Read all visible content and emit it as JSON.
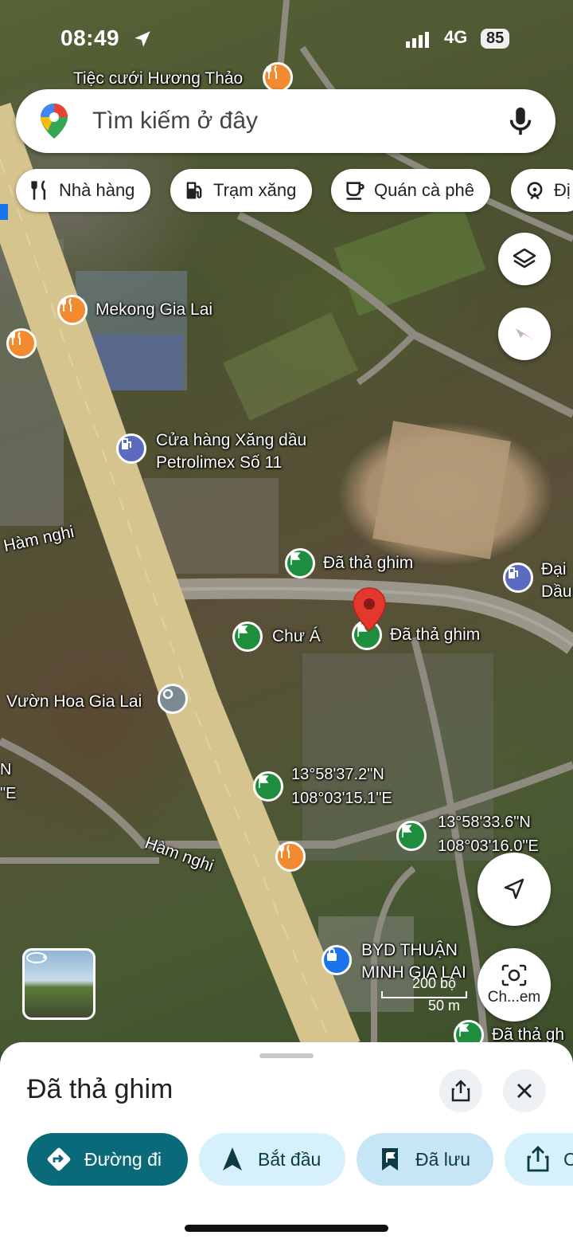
{
  "status_bar": {
    "time": "08:49",
    "network": "4G",
    "battery": "85"
  },
  "search": {
    "placeholder": "Tìm kiếm ở đây"
  },
  "chips": [
    {
      "label": "Nhà hàng",
      "icon": "fork-knife-icon"
    },
    {
      "label": "Trạm xăng",
      "icon": "gas-pump-icon"
    },
    {
      "label": "Quán cà phê",
      "icon": "coffee-cup-icon"
    },
    {
      "label": "Đị",
      "icon": "attraction-icon"
    }
  ],
  "map_labels": {
    "tiec_cuoi": "Tiệc cưới Hương Thảo",
    "mekong": "Mekong Gia Lai",
    "petrolimex_1": "Cửa hàng Xăng dầu",
    "petrolimex_2": "Petrolimex Số 11",
    "ham_nghi_1": "Hàm nghi",
    "ham_nghi_2": "Hàm nghi",
    "da_tha_ghim_top": "Đã thả ghim",
    "dai_1": "Đại",
    "dai_2": "Dầu",
    "chu_a": "Chư Á",
    "da_tha_ghim_selected": "Đã thả ghim",
    "vuon_hoa": "Vườn Hoa Gia Lai",
    "coord1_lat": "13°58'37.2\"N",
    "coord1_lng": "108°03'15.1\"E",
    "coord2_lat": "13°58'33.6\"N",
    "coord2_lng": "108°03'16.0\"E",
    "left_edge_n": "N",
    "left_edge_e": "\"E",
    "byd_1": "BYD THUẬN",
    "byd_2": "MINH GIA LAI",
    "da_tha_ghim_bottom": "Đã thả gh"
  },
  "scale": {
    "imperial": "200 bộ",
    "metric": "50 m"
  },
  "camera_button": {
    "label": "Ch...em"
  },
  "sheet": {
    "title": "Đã thả ghim",
    "actions": [
      {
        "label": "Đường đi",
        "icon": "directions-icon"
      },
      {
        "label": "Bắt đầu",
        "icon": "navigation-arrow-icon"
      },
      {
        "label": "Đã lưu",
        "icon": "bookmark-icon"
      },
      {
        "label": "C",
        "icon": "share-icon"
      }
    ]
  },
  "colors": {
    "primary_dark_teal": "#0b6a7a",
    "chip_light_blue": "#d6f1fb",
    "saved_blue": "#c6e6f5",
    "pin_red": "#e5382d",
    "flag_green": "#1e8e3e"
  }
}
